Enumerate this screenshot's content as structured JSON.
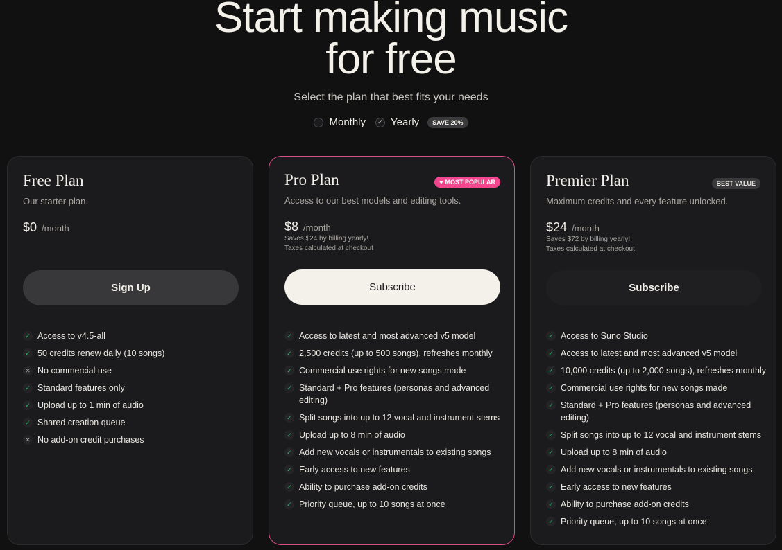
{
  "hero": {
    "title_line1": "Start making music",
    "title_line2": "for free",
    "subtitle": "Select the plan that best fits your needs"
  },
  "billing_toggle": {
    "monthly_label": "Monthly",
    "yearly_label": "Yearly",
    "save_badge": "SAVE 20%",
    "selected": "Yearly"
  },
  "plans": {
    "free": {
      "name": "Free Plan",
      "description": "Our starter plan.",
      "price": "$0",
      "period": "/month",
      "cta": "Sign Up",
      "features": [
        {
          "text": "Access to v4.5-all",
          "included": true
        },
        {
          "text": "50 credits renew daily (10 songs)",
          "included": true
        },
        {
          "text": "No commercial use",
          "included": false
        },
        {
          "text": "Standard features only",
          "included": true
        },
        {
          "text": "Upload up to 1 min of audio",
          "included": true
        },
        {
          "text": "Shared creation queue",
          "included": true
        },
        {
          "text": "No add-on credit purchases",
          "included": false
        }
      ]
    },
    "pro": {
      "name": "Pro Plan",
      "badge": "MOST POPULAR",
      "description": "Access to our best models and editing tools.",
      "price": "$8",
      "period": "/month",
      "savings": "Saves $24 by billing yearly!",
      "taxes": "Taxes calculated at checkout",
      "cta": "Subscribe",
      "features": [
        {
          "text": "Access to latest and most advanced v5 model",
          "included": true
        },
        {
          "text": "2,500 credits (up to 500 songs), refreshes monthly",
          "included": true
        },
        {
          "text": "Commercial use rights for new songs made",
          "included": true
        },
        {
          "text": "Standard + Pro features (personas and advanced editing)",
          "included": true
        },
        {
          "text": "Split songs into up to 12 vocal and instrument stems",
          "included": true
        },
        {
          "text": "Upload up to 8 min of audio",
          "included": true
        },
        {
          "text": "Add new vocals or instrumentals to existing songs",
          "included": true
        },
        {
          "text": "Early access to new features",
          "included": true
        },
        {
          "text": "Ability to purchase add-on credits",
          "included": true
        },
        {
          "text": "Priority queue, up to 10 songs at once",
          "included": true
        }
      ]
    },
    "premier": {
      "name": "Premier Plan",
      "badge": "BEST VALUE",
      "description": "Maximum credits and every feature unlocked.",
      "price": "$24",
      "period": "/month",
      "savings": "Saves $72 by billing yearly!",
      "taxes": "Taxes calculated at checkout",
      "cta": "Subscribe",
      "features": [
        {
          "text": "Access to Suno Studio",
          "included": true
        },
        {
          "text": "Access to latest and most advanced v5 model",
          "included": true
        },
        {
          "text": "10,000 credits (up to 2,000 songs), refreshes monthly",
          "included": true
        },
        {
          "text": "Commercial use rights for new songs made",
          "included": true
        },
        {
          "text": "Standard + Pro features (personas and advanced editing)",
          "included": true
        },
        {
          "text": "Split songs into up to 12 vocal and instrument stems",
          "included": true
        },
        {
          "text": "Upload up to 8 min of audio",
          "included": true
        },
        {
          "text": "Add new vocals or instrumentals to existing songs",
          "included": true
        },
        {
          "text": "Early access to new features",
          "included": true
        },
        {
          "text": "Ability to purchase add-on credits",
          "included": true
        },
        {
          "text": "Priority queue, up to 10 songs at once",
          "included": true
        }
      ]
    }
  },
  "colors": {
    "background": "#111112",
    "card": "#1b1b1d",
    "accent_pink": "#f2468f",
    "check_green": "#27b96b"
  }
}
